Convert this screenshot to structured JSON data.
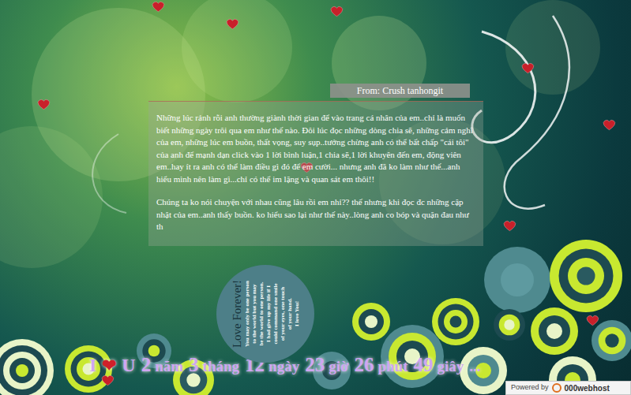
{
  "message": {
    "from": "From: Crush tanhongit",
    "paragraphs": [
      "Những lúc rảnh rỗi anh thường giành thời gian để vào trang cá nhân của em..chỉ là muốn biết những ngày trôi qua em như thế nào. Đôi lúc đọc những dòng chia sẽ, những cảm nghĩ của em, những lúc em buồn, thất vọng, suy sụp..tưởng chừng anh có thể bất chấp \"cái tôi\" của anh để mạnh dạn click vào 1 lời bình luận,1 chia sẽ,1 lời khuyên đến em, động viên em..hay ít ra anh có thể làm điều gì đó để em cười... nhưng anh đã ko làm như thế...anh hiểu mình nên làm gì...chỉ có thể im lặng và quan sát em thôi!!",
      "Chúng ta ko nói chuyện với nhau cũng lâu rồi em nhỉ?? thế nhưng khi đọc đc những cập nhật của em..anh thấy buồn. ko hiểu sao lại như thế này..lòng anh co bóp và quặn đau như th"
    ]
  },
  "quote_circle": {
    "title": "Love Forever!",
    "lines": [
      "You may only be one person",
      "to the world but you may",
      "be the world to one person.",
      "I had give up my life if I",
      "could command one smile",
      "of your eyes, one touch",
      "of your hand.",
      "I love You!"
    ]
  },
  "counter": {
    "prefix": "I",
    "heart": "❤",
    "letter": "U",
    "parts": [
      {
        "value": "2",
        "unit": "năm"
      },
      {
        "value": "3",
        "unit": "tháng"
      },
      {
        "value": "12",
        "unit": "ngày"
      },
      {
        "value": "23",
        "unit": "giờ"
      },
      {
        "value": "26",
        "unit": "phút"
      },
      {
        "value": "49",
        "unit": "giây"
      }
    ],
    "ellipsis": "..."
  },
  "footer_badge": {
    "label": "Powered by",
    "brand": "000webhost"
  }
}
